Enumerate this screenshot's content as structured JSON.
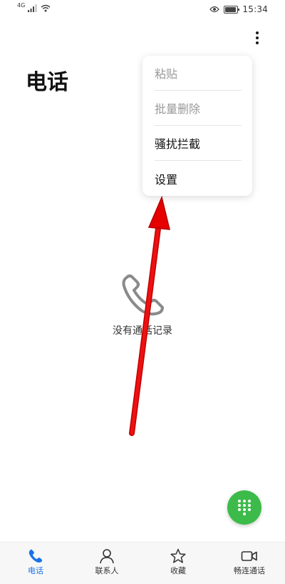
{
  "status_bar": {
    "signal_label": "4G",
    "time": "15:34",
    "battery_level": 0.8
  },
  "header": {
    "title": "电话"
  },
  "menu": {
    "items": [
      {
        "label": "粘贴",
        "enabled": false
      },
      {
        "label": "批量删除",
        "enabled": false
      },
      {
        "label": "骚扰拦截",
        "enabled": true
      },
      {
        "label": "设置",
        "enabled": true
      }
    ]
  },
  "empty_state": {
    "message": "没有通话记录"
  },
  "fab": {
    "icon": "dialpad-icon",
    "color": "#3dbb4a"
  },
  "bottom_nav": {
    "items": [
      {
        "label": "电话",
        "icon": "phone-icon",
        "active": true
      },
      {
        "label": "联系人",
        "icon": "contacts-icon",
        "active": false
      },
      {
        "label": "收藏",
        "icon": "star-icon",
        "active": false
      },
      {
        "label": "畅连通话",
        "icon": "video-call-icon",
        "active": false
      }
    ]
  },
  "colors": {
    "accent": "#1a73e8",
    "annotation_arrow": "#e60000"
  }
}
